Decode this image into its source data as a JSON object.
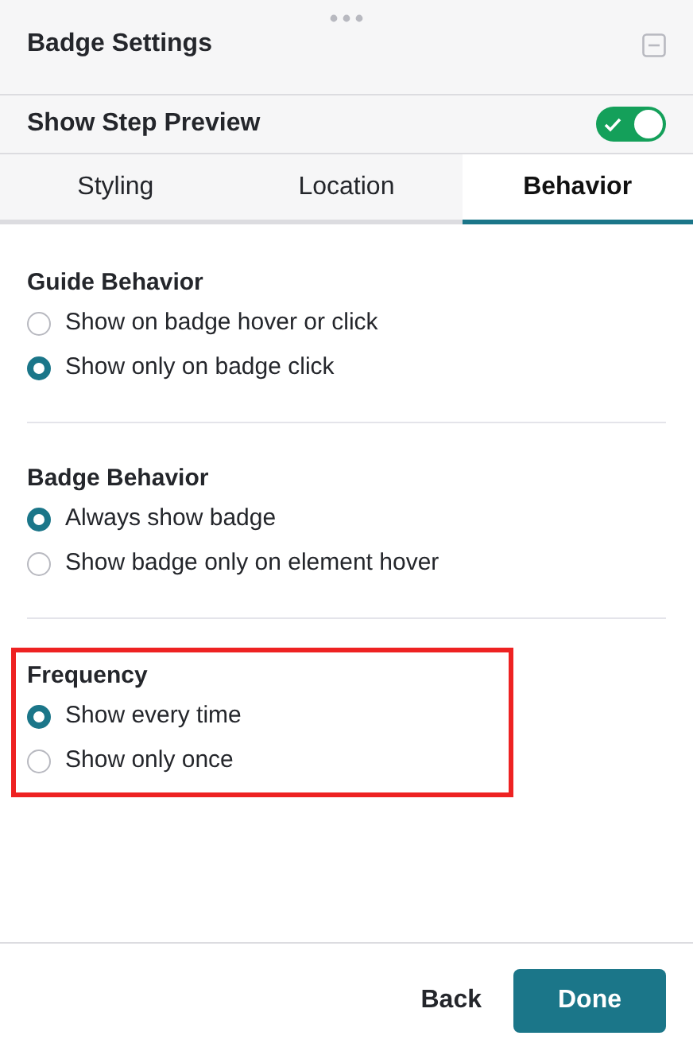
{
  "panel": {
    "title": "Badge Settings"
  },
  "preview_toggle": {
    "label": "Show Step Preview",
    "on": true
  },
  "tabs": [
    {
      "label": "Styling",
      "selected": false
    },
    {
      "label": "Location",
      "selected": false
    },
    {
      "label": "Behavior",
      "selected": true
    }
  ],
  "sections": [
    {
      "heading": "Guide Behavior",
      "highlighted": false,
      "options": [
        {
          "label": "Show on badge hover or click",
          "selected": false
        },
        {
          "label": "Show only on badge click",
          "selected": true
        }
      ]
    },
    {
      "heading": "Badge Behavior",
      "highlighted": false,
      "options": [
        {
          "label": "Always show badge",
          "selected": true
        },
        {
          "label": "Show badge only on element hover",
          "selected": false
        }
      ]
    },
    {
      "heading": "Frequency",
      "highlighted": true,
      "options": [
        {
          "label": "Show every time",
          "selected": true
        },
        {
          "label": "Show only once",
          "selected": false
        }
      ]
    }
  ],
  "footer": {
    "back": "Back",
    "done": "Done"
  }
}
